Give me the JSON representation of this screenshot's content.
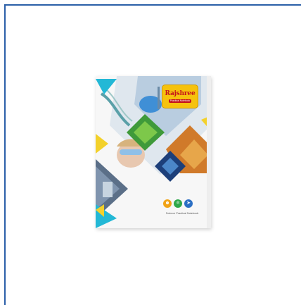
{
  "product": {
    "brand_name": "Rajshree",
    "brand_subtitle": "Practical Notebook",
    "caption": "Science Practical Notebook",
    "icons": [
      "scientist-icon",
      "atom-icon",
      "rocket-icon"
    ],
    "colors": {
      "frame": "#2b5fa8",
      "brand_bg": "#f6c20d",
      "brand_text": "#c4111b",
      "accent_cyan": "#23b8d6",
      "accent_yellow": "#f3d12b",
      "accent_navy": "#1d3f7a"
    }
  }
}
